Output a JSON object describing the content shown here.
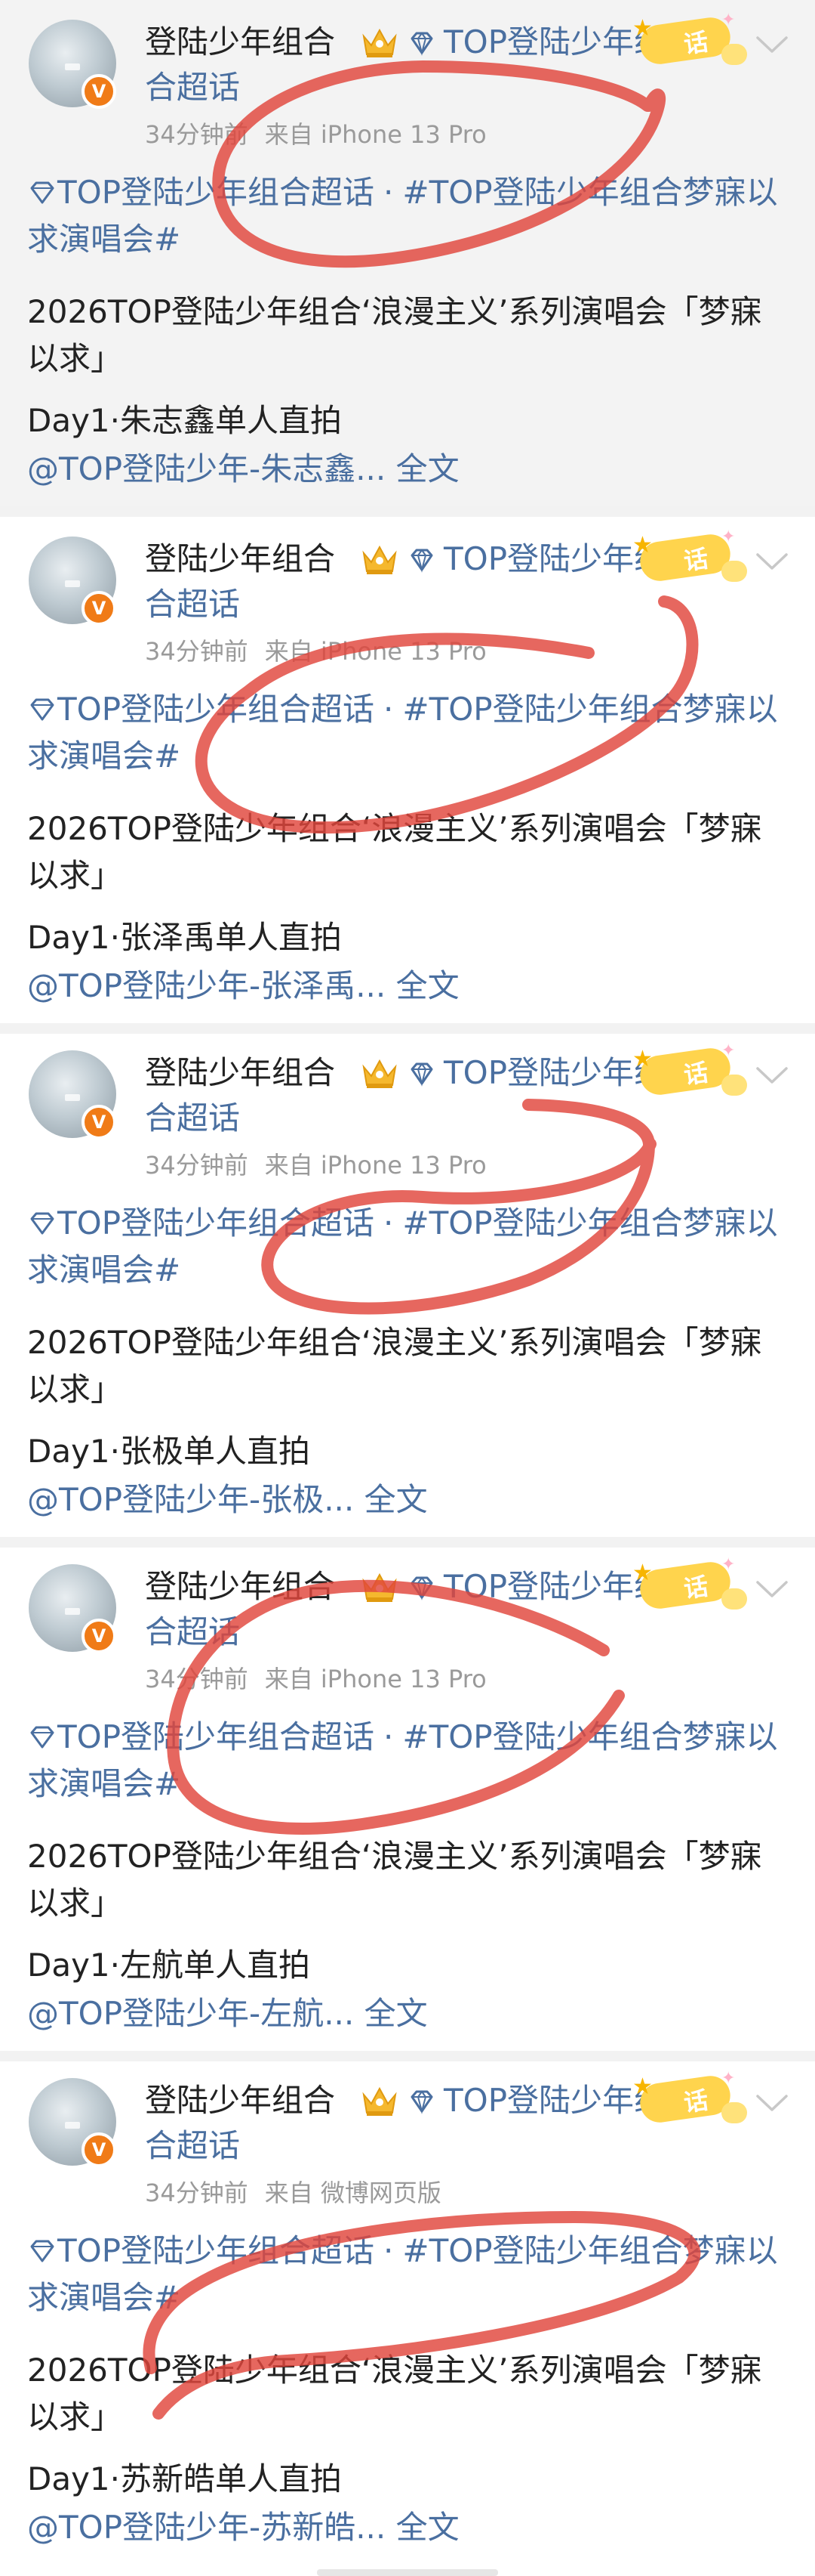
{
  "feed": {
    "posts": [
      {
        "username": "登陆少年组合",
        "topic_inline_1": "TOP登陆少年组",
        "topic_inline_2": "合超话",
        "sticker_text": "话",
        "time": "34分钟前",
        "source": "来自 iPhone 13 Pro",
        "topic_a": "TOP登陆少年组合超话",
        "topic_sep": "·",
        "topic_b": "#TOP登陆少年组合梦寐以求演唱会#",
        "body": "2026TOP登陆少年组合‘浪漫主义’系列演唱会「梦寐以求」",
        "day_line": "Day1·朱志鑫单人直拍",
        "mention": "@TOP登陆少年-朱志鑫...",
        "full_text": "全文"
      },
      {
        "username": "登陆少年组合",
        "topic_inline_1": "TOP登陆少年组",
        "topic_inline_2": "合超话",
        "sticker_text": "话",
        "time": "34分钟前",
        "source": "来自 iPhone 13 Pro",
        "topic_a": "TOP登陆少年组合超话",
        "topic_sep": "·",
        "topic_b": "#TOP登陆少年组合梦寐以求演唱会#",
        "body": "2026TOP登陆少年组合‘浪漫主义’系列演唱会「梦寐以求」",
        "day_line": "Day1·张泽禹单人直拍",
        "mention": "@TOP登陆少年-张泽禹...",
        "full_text": "全文"
      },
      {
        "username": "登陆少年组合",
        "topic_inline_1": "TOP登陆少年组",
        "topic_inline_2": "合超话",
        "sticker_text": "话",
        "time": "34分钟前",
        "source": "来自 iPhone 13 Pro",
        "topic_a": "TOP登陆少年组合超话",
        "topic_sep": "·",
        "topic_b": "#TOP登陆少年组合梦寐以求演唱会#",
        "body": "2026TOP登陆少年组合‘浪漫主义’系列演唱会「梦寐以求」",
        "day_line": "Day1·张极单人直拍",
        "mention": "@TOP登陆少年-张极...",
        "full_text": "全文"
      },
      {
        "username": "登陆少年组合",
        "topic_inline_1": "TOP登陆少年组",
        "topic_inline_2": "合超话",
        "sticker_text": "话",
        "time": "34分钟前",
        "source": "来自 iPhone 13 Pro",
        "topic_a": "TOP登陆少年组合超话",
        "topic_sep": "·",
        "topic_b": "#TOP登陆少年组合梦寐以求演唱会#",
        "body": "2026TOP登陆少年组合‘浪漫主义’系列演唱会「梦寐以求」",
        "day_line": "Day1·左航单人直拍",
        "mention": "@TOP登陆少年-左航...",
        "full_text": "全文"
      },
      {
        "username": "登陆少年组合",
        "topic_inline_1": "TOP登陆少年组",
        "topic_inline_2": "合超话",
        "sticker_text": "话",
        "time": "34分钟前",
        "source": "来自 微博网页版",
        "topic_a": "TOP登陆少年组合超话",
        "topic_sep": "·",
        "topic_b": "#TOP登陆少年组合梦寐以求演唱会#",
        "body": "2026TOP登陆少年组合‘浪漫主义’系列演唱会「梦寐以求」",
        "day_line": "Day1·苏新皓单人直拍",
        "mention": "@TOP登陆少年-苏新皓...",
        "full_text": "全文"
      }
    ]
  },
  "colors": {
    "link": "#4a6fa0",
    "text": "#222222",
    "meta": "#9a9a9a",
    "annotation_stroke": "#e0463c",
    "verified_badge": "#f07b17"
  },
  "icons": [
    "verified-v-icon",
    "crown-icon",
    "diamond-icon",
    "sticker-icon",
    "chevron-down-icon"
  ]
}
